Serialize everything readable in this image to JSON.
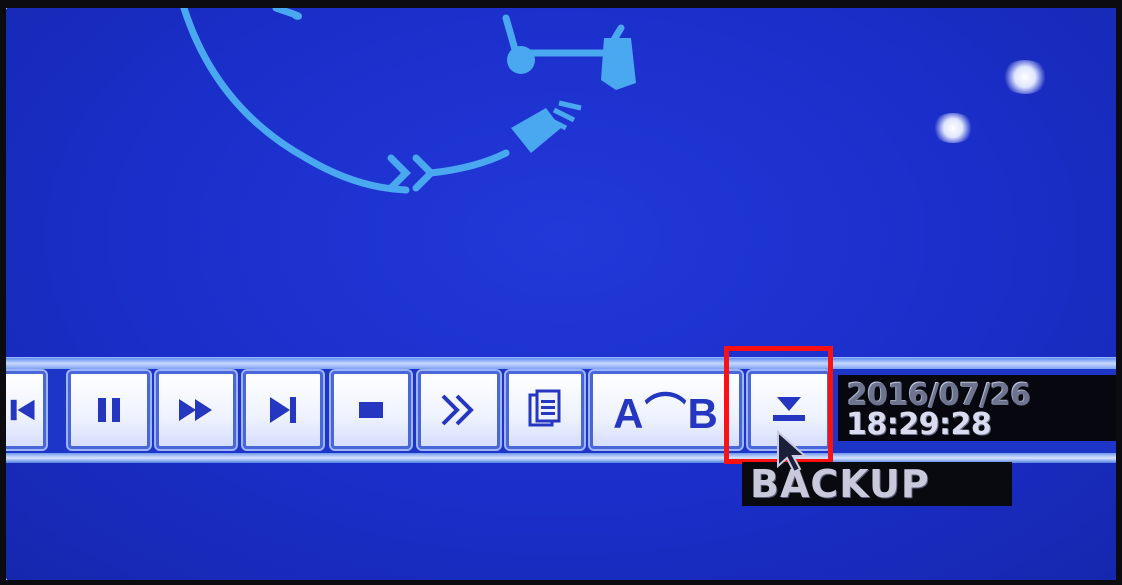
{
  "datetime": {
    "date": "2016/07/26",
    "time": "18:29:28"
  },
  "tooltip": {
    "label": "BACKUP"
  },
  "toolbar": {
    "buttons": [
      {
        "name": "previous-icon"
      },
      {
        "name": "pause-icon"
      },
      {
        "name": "fast-forward-icon"
      },
      {
        "name": "next-frame-icon"
      },
      {
        "name": "stop-icon"
      },
      {
        "name": "skip-forward-icon"
      },
      {
        "name": "clipboard-icon"
      },
      {
        "name": "ab-repeat",
        "label": "A⌒B"
      },
      {
        "name": "backup-download-icon"
      }
    ]
  },
  "colors": {
    "screen_blue": "#1a2ec9",
    "button_face": "#eef2ff",
    "icon_blue": "#2536c0",
    "highlight": "#ff1010"
  }
}
